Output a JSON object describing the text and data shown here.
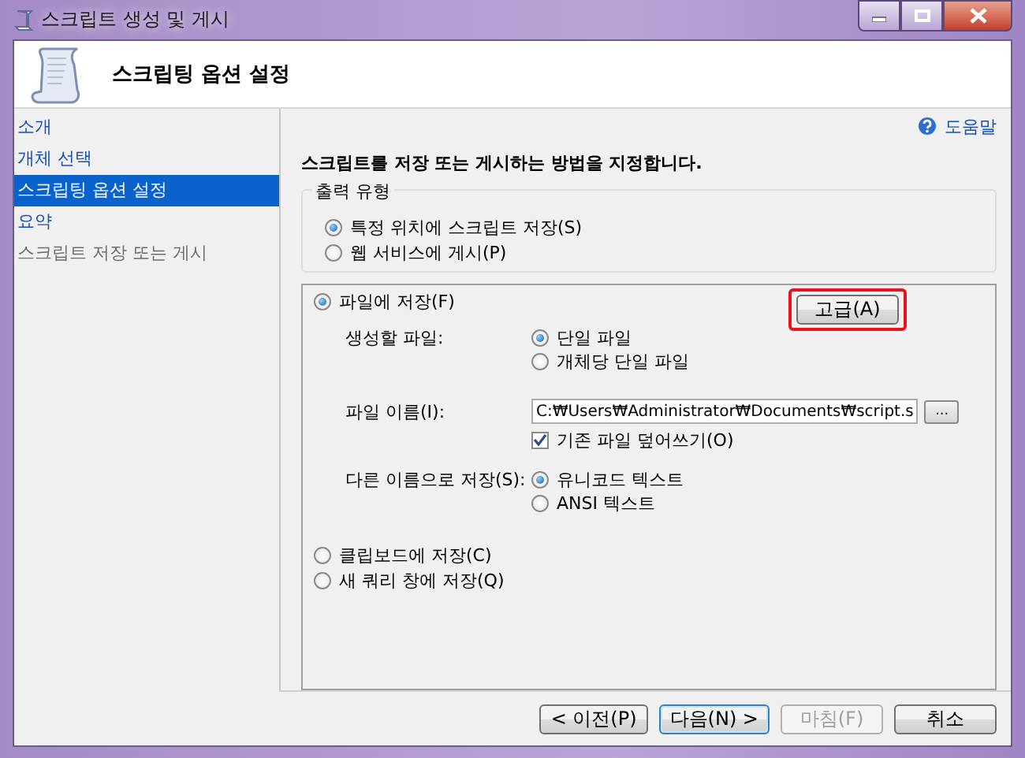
{
  "window": {
    "title": "스크립트 생성 및 게시"
  },
  "header": {
    "title": "스크립팅 옵션 설정"
  },
  "sidebar": {
    "items": [
      {
        "label": "소개",
        "selected": false,
        "disabled": false
      },
      {
        "label": "개체 선택",
        "selected": false,
        "disabled": false
      },
      {
        "label": "스크립팅 옵션 설정",
        "selected": true,
        "disabled": false
      },
      {
        "label": "요약",
        "selected": false,
        "disabled": false
      },
      {
        "label": "스크립트 저장 또는 게시",
        "selected": false,
        "disabled": true
      }
    ]
  },
  "help_link": "도움말",
  "instruction": "스크립트를 저장 또는 게시하는 방법을 지정합니다.",
  "output_type": {
    "label": "출력 유형",
    "options": [
      {
        "label": "특정 위치에 스크립트 저장(S)",
        "selected": true
      },
      {
        "label": "웹 서비스에 게시(P)",
        "selected": false
      }
    ]
  },
  "destinations": [
    {
      "label": "파일에 저장(F)",
      "selected": true
    },
    {
      "label": "클립보드에 저장(C)",
      "selected": false
    },
    {
      "label": "새 쿼리 창에 저장(Q)",
      "selected": false
    }
  ],
  "file_options": {
    "advanced_button": {
      "label": "고급(A)",
      "highlighted": true
    },
    "files_to_generate": {
      "label": "생성할 파일:",
      "options": [
        {
          "label": "단일 파일",
          "selected": true
        },
        {
          "label": "개체당 단일 파일",
          "selected": false
        }
      ]
    },
    "file_name": {
      "label": "파일 이름(I):",
      "value": "C:₩Users₩Administrator₩Documents₩script.s",
      "browse_label": "..."
    },
    "overwrite": {
      "label": "기존 파일 덮어쓰기(O)",
      "checked": true
    },
    "save_as": {
      "label": "다른 이름으로 저장(S):",
      "options": [
        {
          "label": "유니코드 텍스트",
          "selected": true
        },
        {
          "label": "ANSI 텍스트",
          "selected": false
        }
      ]
    }
  },
  "buttons": [
    {
      "label": "< 이전(P)",
      "disabled": false,
      "default": false
    },
    {
      "label": "다음(N) >",
      "disabled": false,
      "default": true
    },
    {
      "label": "마침(F)",
      "disabled": true,
      "default": false
    },
    {
      "label": "취소",
      "disabled": false,
      "default": false
    }
  ]
}
